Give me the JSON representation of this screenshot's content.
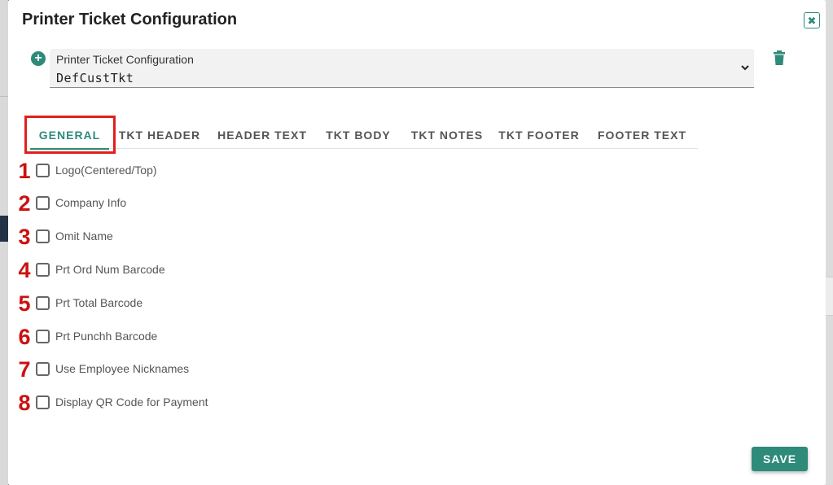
{
  "modal": {
    "title": "Printer Ticket Configuration"
  },
  "selector": {
    "label": "Printer Ticket Configuration",
    "value": "DefCustTkt"
  },
  "tabs": [
    {
      "label": "GENERAL",
      "active": true
    },
    {
      "label": "TKT HEADER",
      "active": false
    },
    {
      "label": "HEADER TEXT",
      "active": false
    },
    {
      "label": "TKT BODY",
      "active": false
    },
    {
      "label": "TKT NOTES",
      "active": false
    },
    {
      "label": "TKT FOOTER",
      "active": false
    },
    {
      "label": "FOOTER TEXT",
      "active": false
    }
  ],
  "options": [
    {
      "num": "1",
      "label": "Logo(Centered/Top)",
      "checked": false
    },
    {
      "num": "2",
      "label": "Company Info",
      "checked": false
    },
    {
      "num": "3",
      "label": "Omit Name",
      "checked": false
    },
    {
      "num": "4",
      "label": "Prt Ord Num Barcode",
      "checked": false
    },
    {
      "num": "5",
      "label": "Prt Total Barcode",
      "checked": false
    },
    {
      "num": "6",
      "label": "Prt Punchh Barcode",
      "checked": false
    },
    {
      "num": "7",
      "label": "Use Employee Nicknames",
      "checked": false
    },
    {
      "num": "8",
      "label": "Display QR Code for Payment",
      "checked": false
    }
  ],
  "footer": {
    "save_label": "SAVE"
  },
  "colors": {
    "accent": "#2e8b7a",
    "annotation": "#e0201b"
  },
  "icons": {
    "close": "close-icon",
    "add": "add-circle-icon",
    "dropdown": "chevron-down-icon",
    "delete": "trash-icon"
  }
}
